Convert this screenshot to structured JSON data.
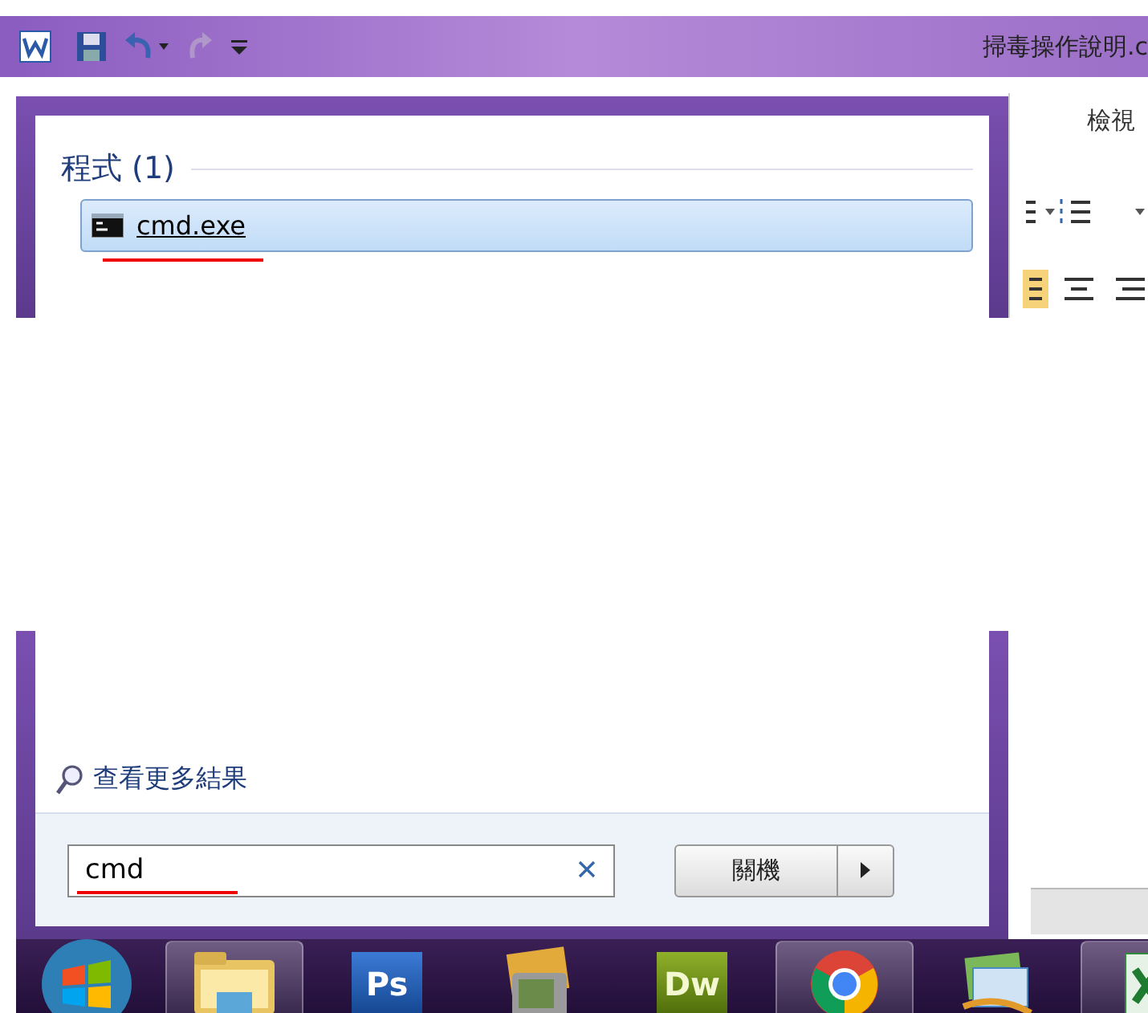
{
  "title_bar": {
    "title": "掃毒操作說明.c"
  },
  "ribbon": {
    "tab": "檢視"
  },
  "start_menu": {
    "section": "程式 (1)",
    "results": [
      {
        "label": "cmd.exe",
        "selected": true,
        "annotated": true
      }
    ],
    "more_results": "查看更多結果",
    "search": {
      "value": "cmd",
      "annotated": true
    },
    "shutdown": "關機"
  },
  "taskbar": {
    "apps": [
      {
        "kind": "start",
        "running": false
      },
      {
        "kind": "explorer",
        "running": true
      },
      {
        "kind": "ps",
        "label": "Ps",
        "running": false
      },
      {
        "kind": "photo",
        "running": false
      },
      {
        "kind": "dw",
        "label": "Dw",
        "running": false
      },
      {
        "kind": "chrome",
        "running": true
      },
      {
        "kind": "mail",
        "running": false
      },
      {
        "kind": "excel",
        "running": true
      }
    ]
  }
}
